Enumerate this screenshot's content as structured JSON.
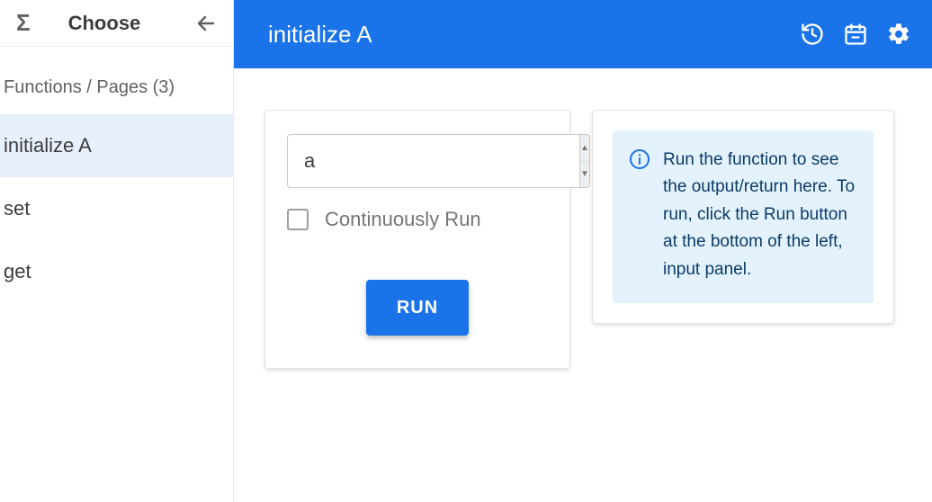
{
  "sidebar": {
    "choose_label": "Choose",
    "section_header": "Functions / Pages (3)",
    "items": [
      {
        "label": "initialize A",
        "selected": true
      },
      {
        "label": "set",
        "selected": false
      },
      {
        "label": "get",
        "selected": false
      }
    ]
  },
  "titlebar": {
    "title": "initialize A"
  },
  "input_panel": {
    "field_value": "a",
    "continuously_run_label": "Continuously Run",
    "continuously_run_checked": false,
    "run_label": "RUN"
  },
  "output_panel": {
    "info_text": "Run the function to see the output/return here. To run, click the Run button at the bottom of the left, input panel."
  },
  "icons": {
    "sigma": "Σ"
  }
}
